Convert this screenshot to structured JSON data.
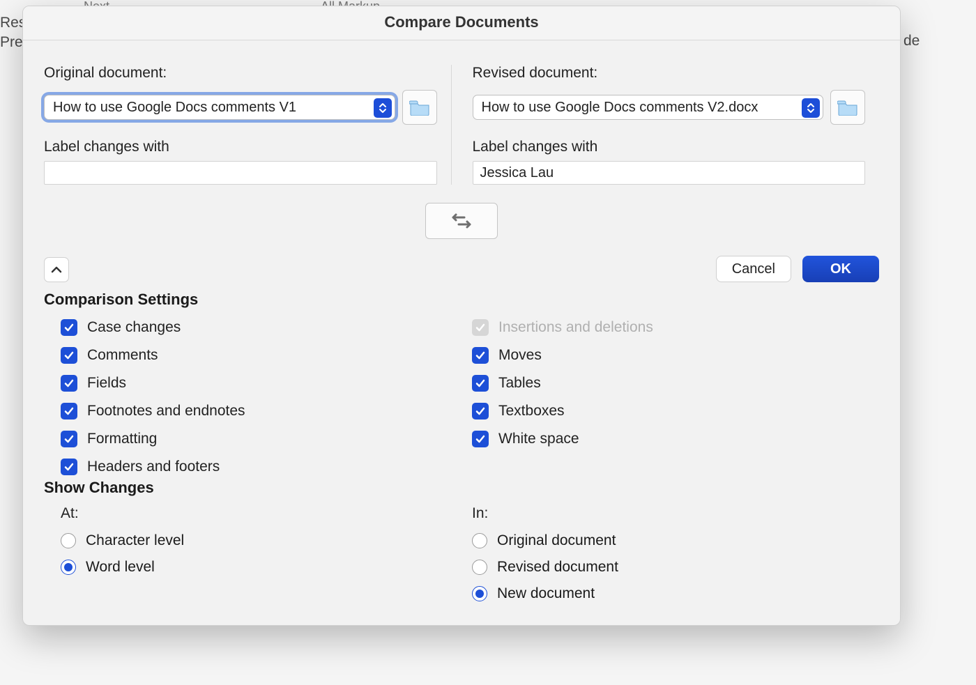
{
  "dialog": {
    "title": "Compare Documents",
    "original": {
      "label": "Original document:",
      "select_value": "How to use Google Docs comments V1",
      "changes_label": "Label changes with",
      "changes_value": ""
    },
    "revised": {
      "label": "Revised document:",
      "select_value": "How to use Google Docs comments V2.docx",
      "changes_label": "Label changes with",
      "changes_value": "Jessica Lau"
    },
    "buttons": {
      "cancel": "Cancel",
      "ok": "OK"
    },
    "comparison_settings": {
      "header": "Comparison Settings",
      "left": {
        "case_changes": "Case changes",
        "comments": "Comments",
        "fields": "Fields",
        "footnotes": "Footnotes and endnotes",
        "formatting": "Formatting",
        "headers": "Headers and footers"
      },
      "right": {
        "insertions": "Insertions and deletions",
        "moves": "Moves",
        "tables": "Tables",
        "textboxes": "Textboxes",
        "white_space": "White space"
      }
    },
    "show_changes": {
      "header": "Show Changes",
      "at_label": "At:",
      "at_options": {
        "char": "Character level",
        "word": "Word level"
      },
      "in_label": "In:",
      "in_options": {
        "original": "Original document",
        "revised": "Revised document",
        "new": "New document"
      }
    }
  },
  "background": {
    "toolbar_next": "Next",
    "toolbar_markup": "All Markup",
    "left_frag_1": "Res",
    "left_frag_2": "Pre",
    "right_frag_1": "de"
  }
}
